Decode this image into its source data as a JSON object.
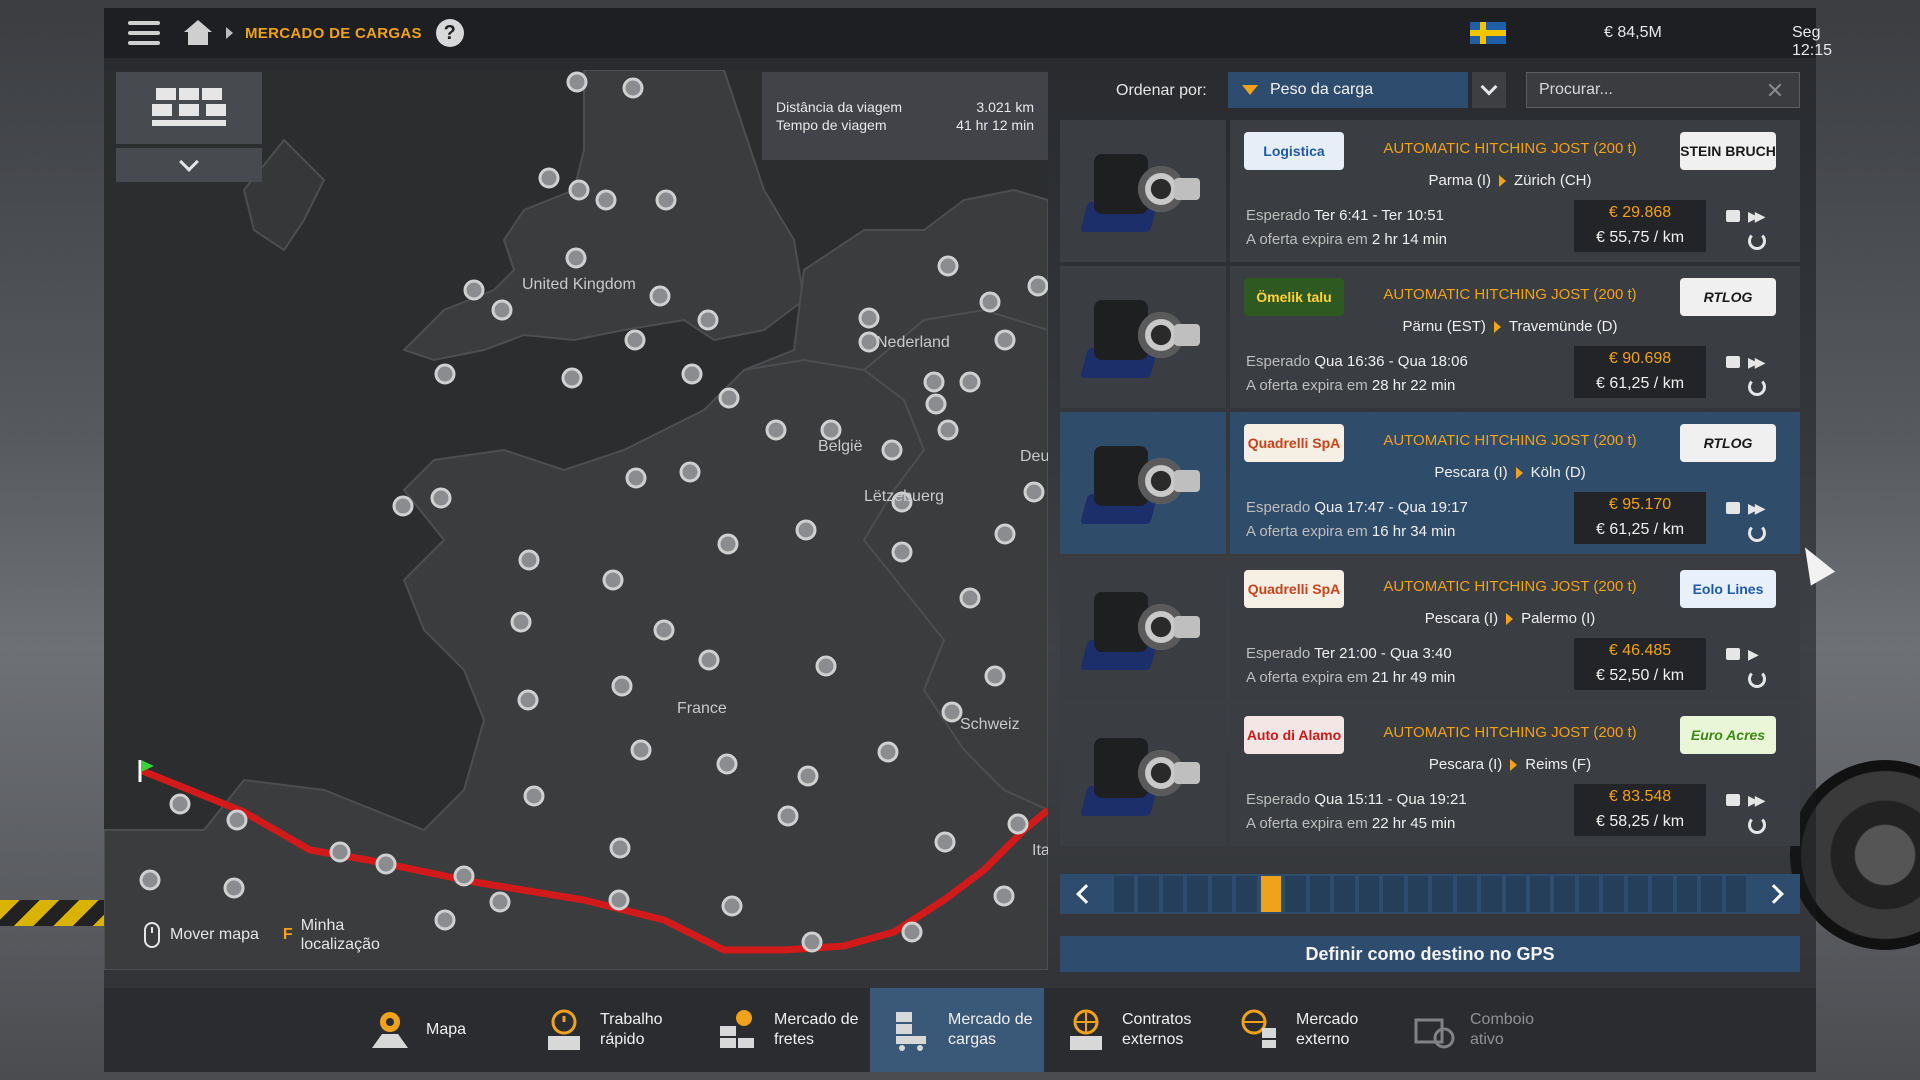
{
  "topbar": {
    "breadcrumb": "MERCADO DE CARGAS",
    "help": "?",
    "money": "€ 84,5M",
    "clock": "Seg 12:15"
  },
  "map": {
    "trip": {
      "distance_label": "Distância da viagem",
      "distance_value": "3.021 km",
      "time_label": "Tempo de viagem",
      "time_value": "41 hr 12 min"
    },
    "labels": [
      "United Kingdom",
      "Nederland",
      "België",
      "Lëtzebuerg",
      "Deu",
      "France",
      "Schweiz",
      "Ita"
    ],
    "hint_move": "Mover mapa",
    "hint_key": "F",
    "hint_location_1": "Minha",
    "hint_location_2": "localização"
  },
  "sort": {
    "label": "Ordenar por:",
    "value": "Peso da carga"
  },
  "search": {
    "placeholder": "Procurar..."
  },
  "jobs": [
    {
      "cargo": "AUTOMATIC HITCHING JOST (200 t)",
      "origin": "Parma (I)",
      "destination": "Zürich (CH)",
      "expected_label": "Esperado",
      "expected": "Ter 6:41 - Ter 10:51",
      "expire_label": "A oferta expira em",
      "expire": "2 hr 14 min",
      "price": "€ 29.868",
      "per_km": "€ 55,75 / km",
      "logo_left": "Logistica",
      "logo_right": "STEIN BRUCH",
      "urgency": "double"
    },
    {
      "cargo": "AUTOMATIC HITCHING JOST (200 t)",
      "origin": "Pärnu (EST)",
      "destination": "Travemünde (D)",
      "expected_label": "Esperado",
      "expected": "Qua 16:36 - Qua 18:06",
      "expire_label": "A oferta expira em",
      "expire": "28 hr 22 min",
      "price": "€ 90.698",
      "per_km": "€ 61,25 / km",
      "logo_left": "Ömelik talu",
      "logo_right": "RTLOG",
      "urgency": "triple"
    },
    {
      "cargo": "AUTOMATIC HITCHING JOST (200 t)",
      "origin": "Pescara (I)",
      "destination": "Köln (D)",
      "expected_label": "Esperado",
      "expected": "Qua 17:47 - Qua 19:17",
      "expire_label": "A oferta expira em",
      "expire": "16 hr 34 min",
      "price": "€ 95.170",
      "per_km": "€ 61,25 / km",
      "logo_left": "Quadrelli SpA",
      "logo_right": "RTLOG",
      "urgency": "triple"
    },
    {
      "cargo": "AUTOMATIC HITCHING JOST (200 t)",
      "origin": "Pescara (I)",
      "destination": "Palermo (I)",
      "expected_label": "Esperado",
      "expected": "Ter 21:00 - Qua 3:40",
      "expire_label": "A oferta expira em",
      "expire": "21 hr 49 min",
      "price": "€ 46.485",
      "per_km": "€ 52,50 / km",
      "logo_left": "Quadrelli SpA",
      "logo_right": "Eolo Lines",
      "urgency": "single"
    },
    {
      "cargo": "AUTOMATIC HITCHING JOST (200 t)",
      "origin": "Pescara (I)",
      "destination": "Reims (F)",
      "expected_label": "Esperado",
      "expected": "Qua 15:11 - Qua 19:21",
      "expire_label": "A oferta expira em",
      "expire": "22 hr 45 min",
      "price": "€ 83.548",
      "per_km": "€ 58,25 / km",
      "logo_left": "Auto di Alamo",
      "logo_right": "Euro Acres",
      "urgency": "double"
    }
  ],
  "pager": {
    "total_pages": 26,
    "current_page": 7
  },
  "gps_button": "Definir como destino no GPS",
  "bottom_nav": [
    {
      "label1": "Mapa",
      "label2": "",
      "icon": "map-icon",
      "state": "normal"
    },
    {
      "label1": "Trabalho",
      "label2": "rápido",
      "icon": "quick-job-icon",
      "state": "normal"
    },
    {
      "label1": "Mercado de",
      "label2": "fretes",
      "icon": "freight-market-icon",
      "state": "normal"
    },
    {
      "label1": "Mercado de",
      "label2": "cargas",
      "icon": "cargo-market-icon",
      "state": "active"
    },
    {
      "label1": "Contratos",
      "label2": "externos",
      "icon": "external-contracts-icon",
      "state": "normal"
    },
    {
      "label1": "Mercado",
      "label2": "externo",
      "icon": "external-market-icon",
      "state": "normal"
    },
    {
      "label1": "Comboio",
      "label2": "ativo",
      "icon": "convoy-icon",
      "state": "disabled"
    }
  ],
  "colors": {
    "accent": "#f0a21a",
    "selected": "#2f4c6a",
    "route": "#d21a1a"
  }
}
